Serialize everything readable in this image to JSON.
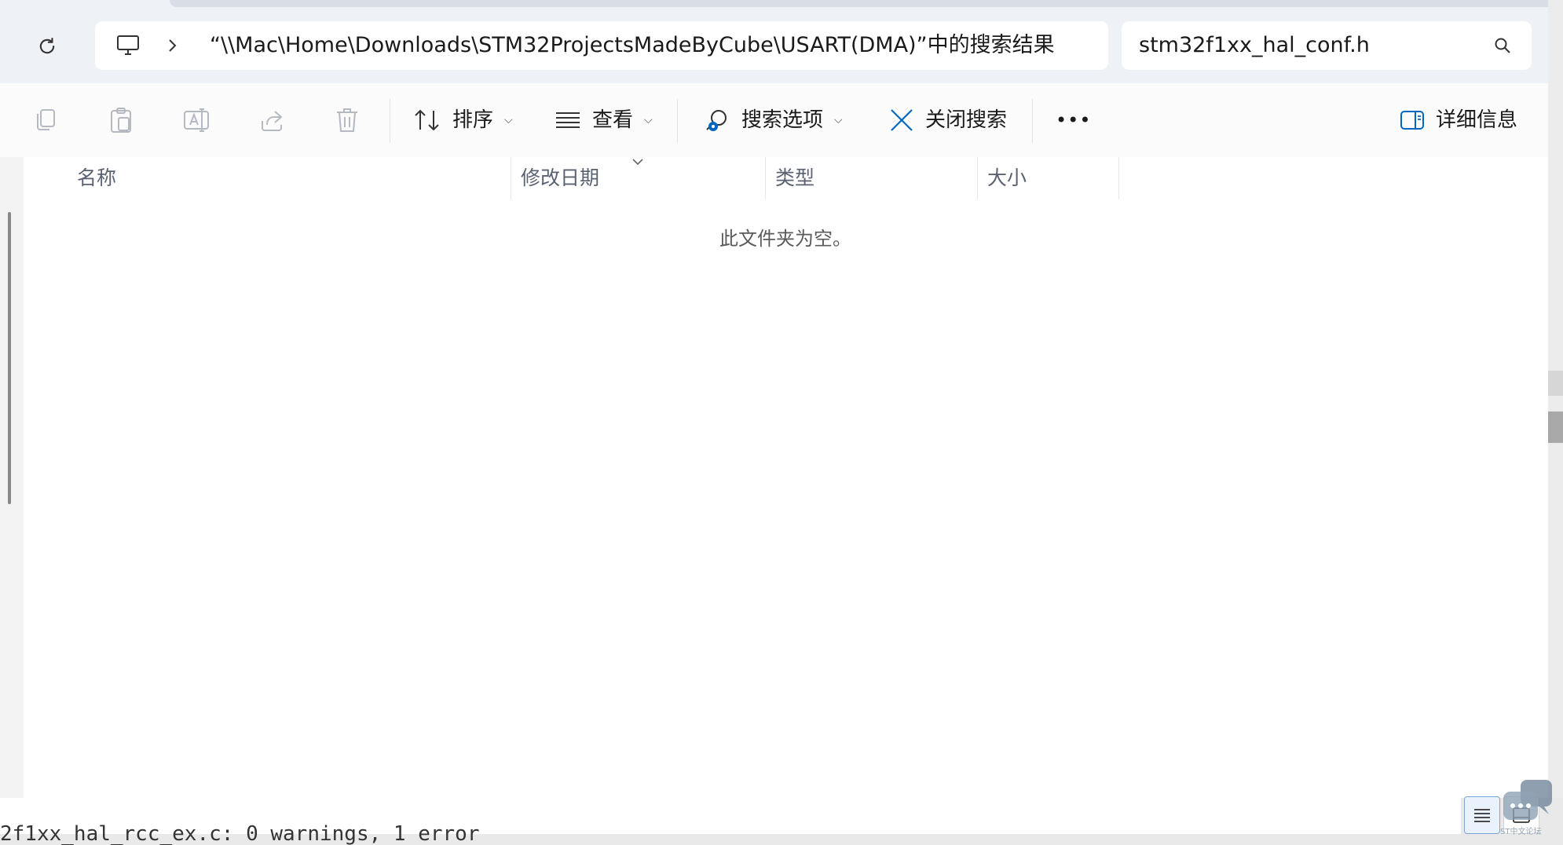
{
  "nav": {
    "refresh_icon": "refresh-icon"
  },
  "address_bar": {
    "location_icon": "this-pc-icon",
    "path_text": "“\\\\Mac\\Home\\Downloads\\STM32ProjectsMadeByCube\\USART(DMA)”中的搜索结果"
  },
  "search": {
    "value": "stm32f1xx_hal_conf.h",
    "icon": "search-icon"
  },
  "toolbar": {
    "sort_label": "排序",
    "view_label": "查看",
    "search_options_label": "搜索选项",
    "close_search_label": "关闭搜索",
    "more_label": "•••",
    "details_label": "详细信息"
  },
  "columns": [
    {
      "label": "名称"
    },
    {
      "label": "修改日期"
    },
    {
      "label": "类型"
    },
    {
      "label": "大小"
    }
  ],
  "content": {
    "empty_message": "此文件夹为空。"
  },
  "console": {
    "text": "2f1xx_hal_rcc_ex.c: 0 warnings, 1 error"
  },
  "watermark": {
    "text": "ST中文论坛"
  },
  "colors": {
    "accent": "#0067c0",
    "topbar_bg": "#eef1f6",
    "toolbar_bg": "#fbfbfc"
  }
}
